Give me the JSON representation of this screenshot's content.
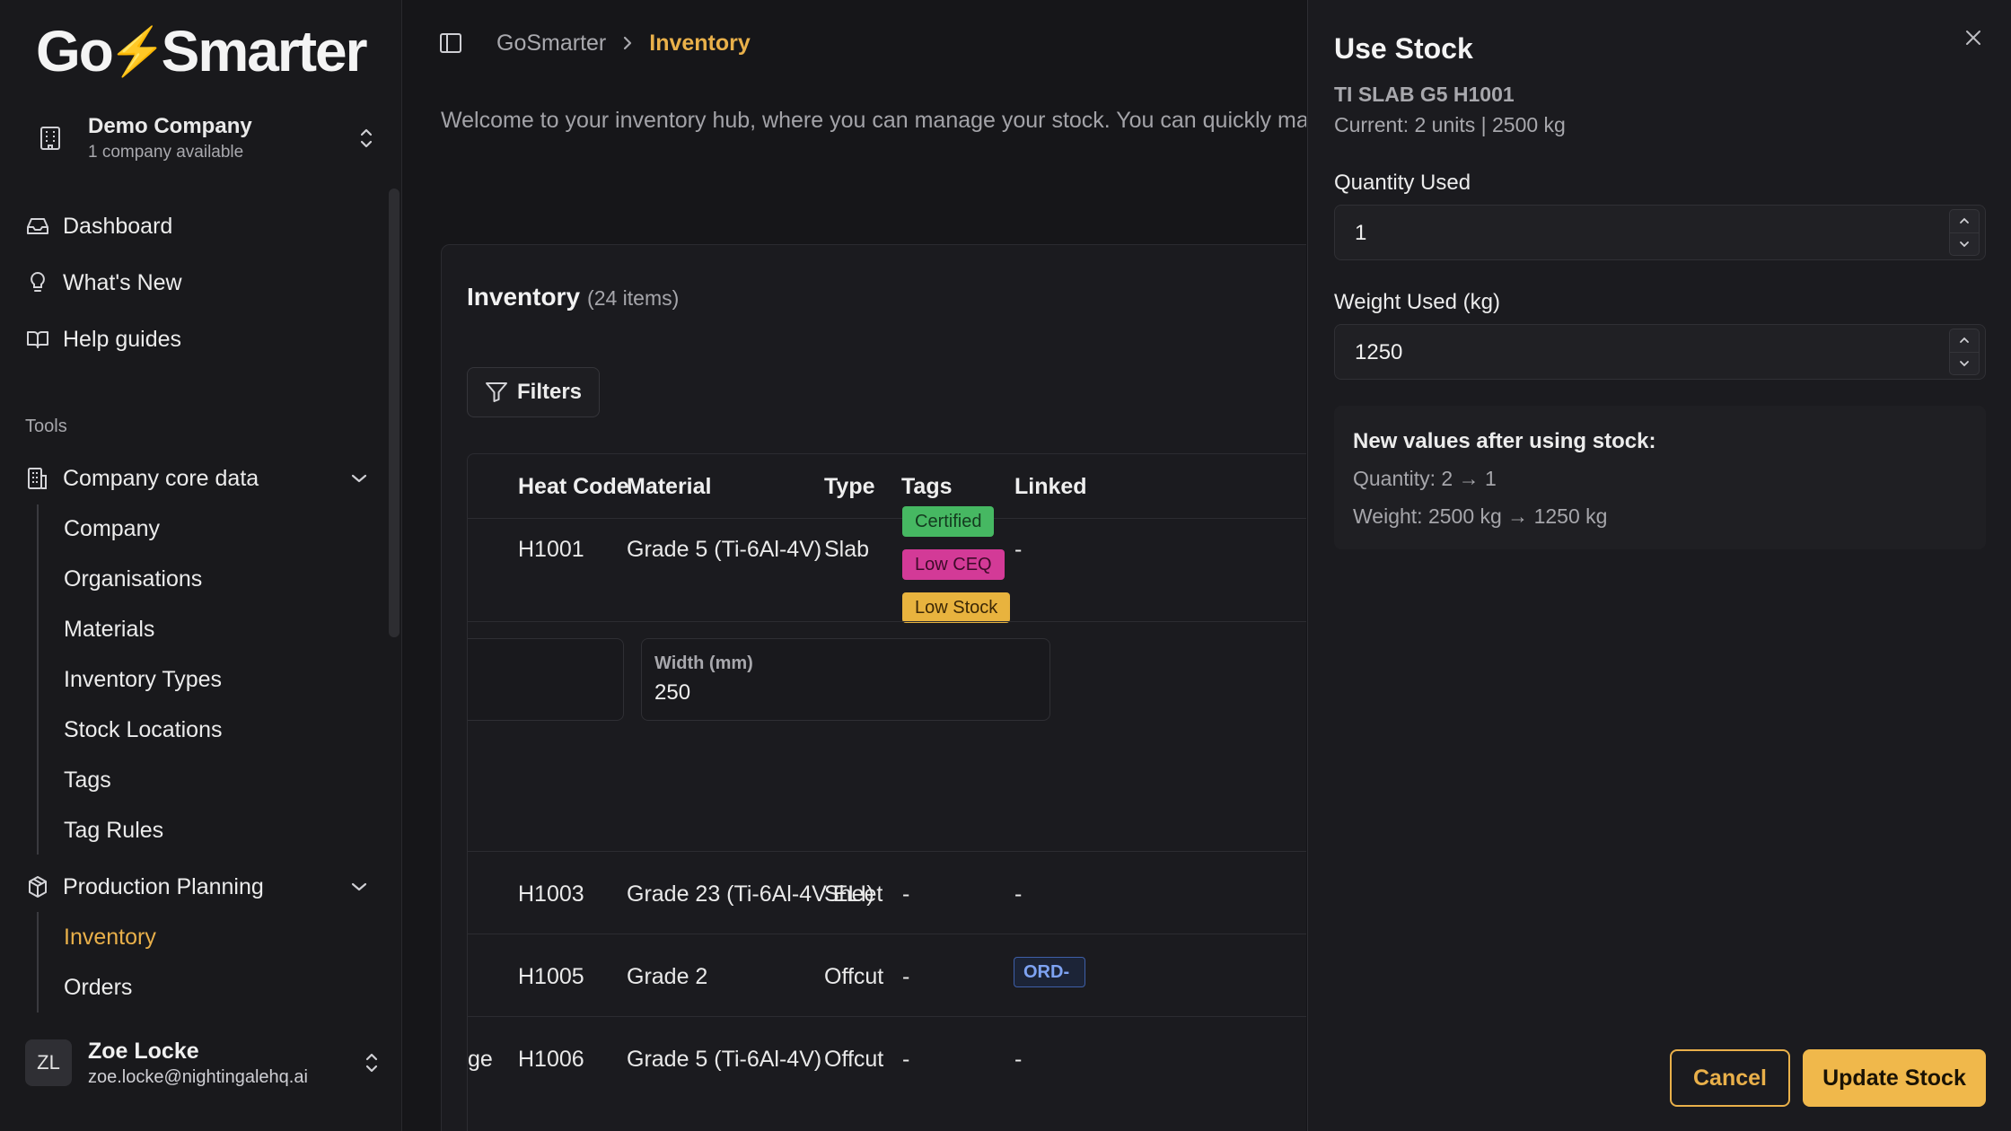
{
  "brand": {
    "logo_left": "Go",
    "logo_bolt": "⚡",
    "logo_right": "Smarter",
    "accent": "#e9b04a"
  },
  "company": {
    "name": "Demo Company",
    "subtitle": "1 company available"
  },
  "nav": {
    "dashboard": "Dashboard",
    "whats_new": "What's New",
    "help": "Help guides",
    "tools_label": "Tools",
    "core_data": "Company core data",
    "core_items": [
      "Company",
      "Organisations",
      "Materials",
      "Inventory Types",
      "Stock Locations",
      "Tags",
      "Tag Rules"
    ],
    "production": "Production Planning",
    "production_items": [
      "Inventory",
      "Orders"
    ]
  },
  "user": {
    "initials": "ZL",
    "name": "Zoe Locke",
    "email": "zoe.locke@nightingalehq.ai"
  },
  "breadcrumb": {
    "root": "GoSmarter",
    "current": "Inventory"
  },
  "welcome": "Welcome to your inventory hub, where you can manage your stock. You can quickly mana",
  "inventory": {
    "title": "Inventory",
    "count": "(24 items)",
    "filters_label": "Filters",
    "columns": [
      "Heat Code",
      "Material",
      "Type",
      "Tags",
      "Linked"
    ],
    "rows": [
      {
        "heat": "H1001",
        "material": "Grade 5 (Ti-6Al-4V)",
        "type": "Slab",
        "tags": [
          "Certified",
          "Low CEQ",
          "Low Stock"
        ],
        "linked": "-"
      },
      {
        "heat": "H1003",
        "material": "Grade 23 (Ti-6Al-4V ELI)",
        "type": "Sheet",
        "tags_text": "-",
        "linked": "-"
      },
      {
        "heat": "H1005",
        "material": "Grade 2",
        "type": "Offcut",
        "tags_text": "-",
        "linked": "ORD-"
      },
      {
        "prefix": "ge",
        "heat": "H1006",
        "material": "Grade 5 (Ti-6Al-4V)",
        "type": "Offcut",
        "tags_text": "-",
        "linked": "-"
      }
    ],
    "detail": {
      "width_label": "Width (mm)",
      "width_value": "250"
    }
  },
  "drawer": {
    "title": "Use Stock",
    "item": "TI SLAB G5 H1001",
    "current": "Current: 2 units | 2500 kg",
    "quantity_label": "Quantity Used",
    "quantity_value": "1",
    "weight_label": "Weight Used (kg)",
    "weight_value": "1250",
    "preview_title": "New values after using stock:",
    "preview_quantity": "Quantity: 2 → 1",
    "preview_weight": "Weight: 2500 kg → 1250 kg",
    "cancel": "Cancel",
    "update": "Update Stock"
  }
}
